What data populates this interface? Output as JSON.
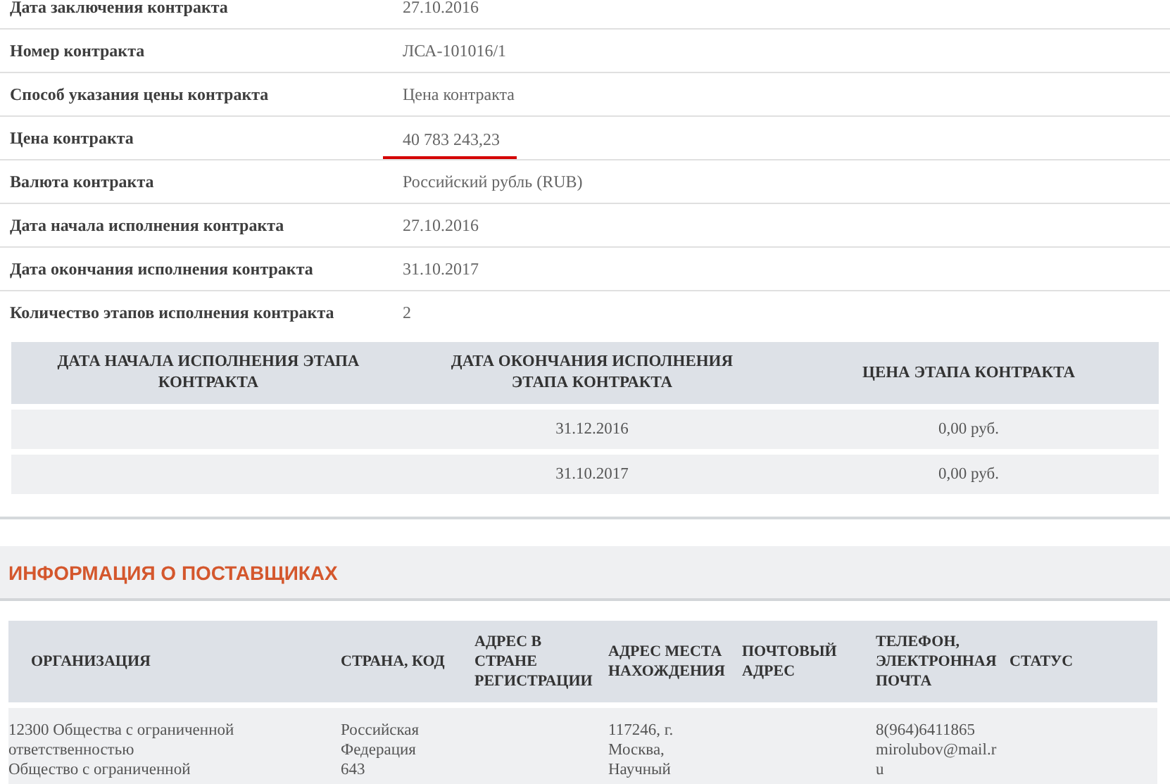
{
  "contract_fields": [
    {
      "label": "Дата заключения контракта",
      "value": "27.10.2016",
      "underlined": false
    },
    {
      "label": "Номер контракта",
      "value": "ЛСА-101016/1",
      "underlined": false
    },
    {
      "label": "Способ указания цены контракта",
      "value": "Цена контракта",
      "underlined": false
    },
    {
      "label": "Цена контракта",
      "value": "40 783 243,23",
      "underlined": true
    },
    {
      "label": "Валюта контракта",
      "value": "Российский рубль (RUB)",
      "underlined": false
    },
    {
      "label": "Дата начала исполнения контракта",
      "value": "27.10.2016",
      "underlined": false
    },
    {
      "label": "Дата окончания исполнения контракта",
      "value": "31.10.2017",
      "underlined": false
    },
    {
      "label": "Количество этапов исполнения контракта",
      "value": "2",
      "underlined": false
    }
  ],
  "stages_table": {
    "columns": [
      "ДАТА НАЧАЛА ИСПОЛНЕНИЯ ЭТАПА КОНТРАКТА",
      "ДАТА ОКОНЧАНИЯ ИСПОЛНЕНИЯ ЭТАПА КОНТРАКТА",
      "ЦЕНА ЭТАПА КОНТРАКТА"
    ],
    "rows": [
      [
        "",
        "31.12.2016",
        "0,00 руб."
      ],
      [
        "",
        "31.10.2017",
        "0,00 руб."
      ]
    ]
  },
  "suppliers_section": {
    "title": "ИНФОРМАЦИЯ О ПОСТАВЩИКАХ",
    "columns": [
      "ОРГАНИЗАЦИЯ",
      "СТРАНА, КОД",
      "АДРЕС В СТРАНЕ РЕГИСТРАЦИИ",
      "АДРЕС МЕСТА НАХОЖДЕНИЯ",
      "ПОЧТОВЫЙ АДРЕС",
      "ТЕЛЕФОН, ЭЛЕКТРОННАЯ ПОЧТА",
      "СТАТУС"
    ],
    "rows": [
      [
        "12300 Общества с ограниченной ответственностью\nОбщество с ограниченной",
        "Российская Федерация\n643",
        "",
        "117246, г. Москва, Научный",
        "",
        "8(964)6411865\nmirolubov@mail.ru",
        ""
      ]
    ]
  }
}
